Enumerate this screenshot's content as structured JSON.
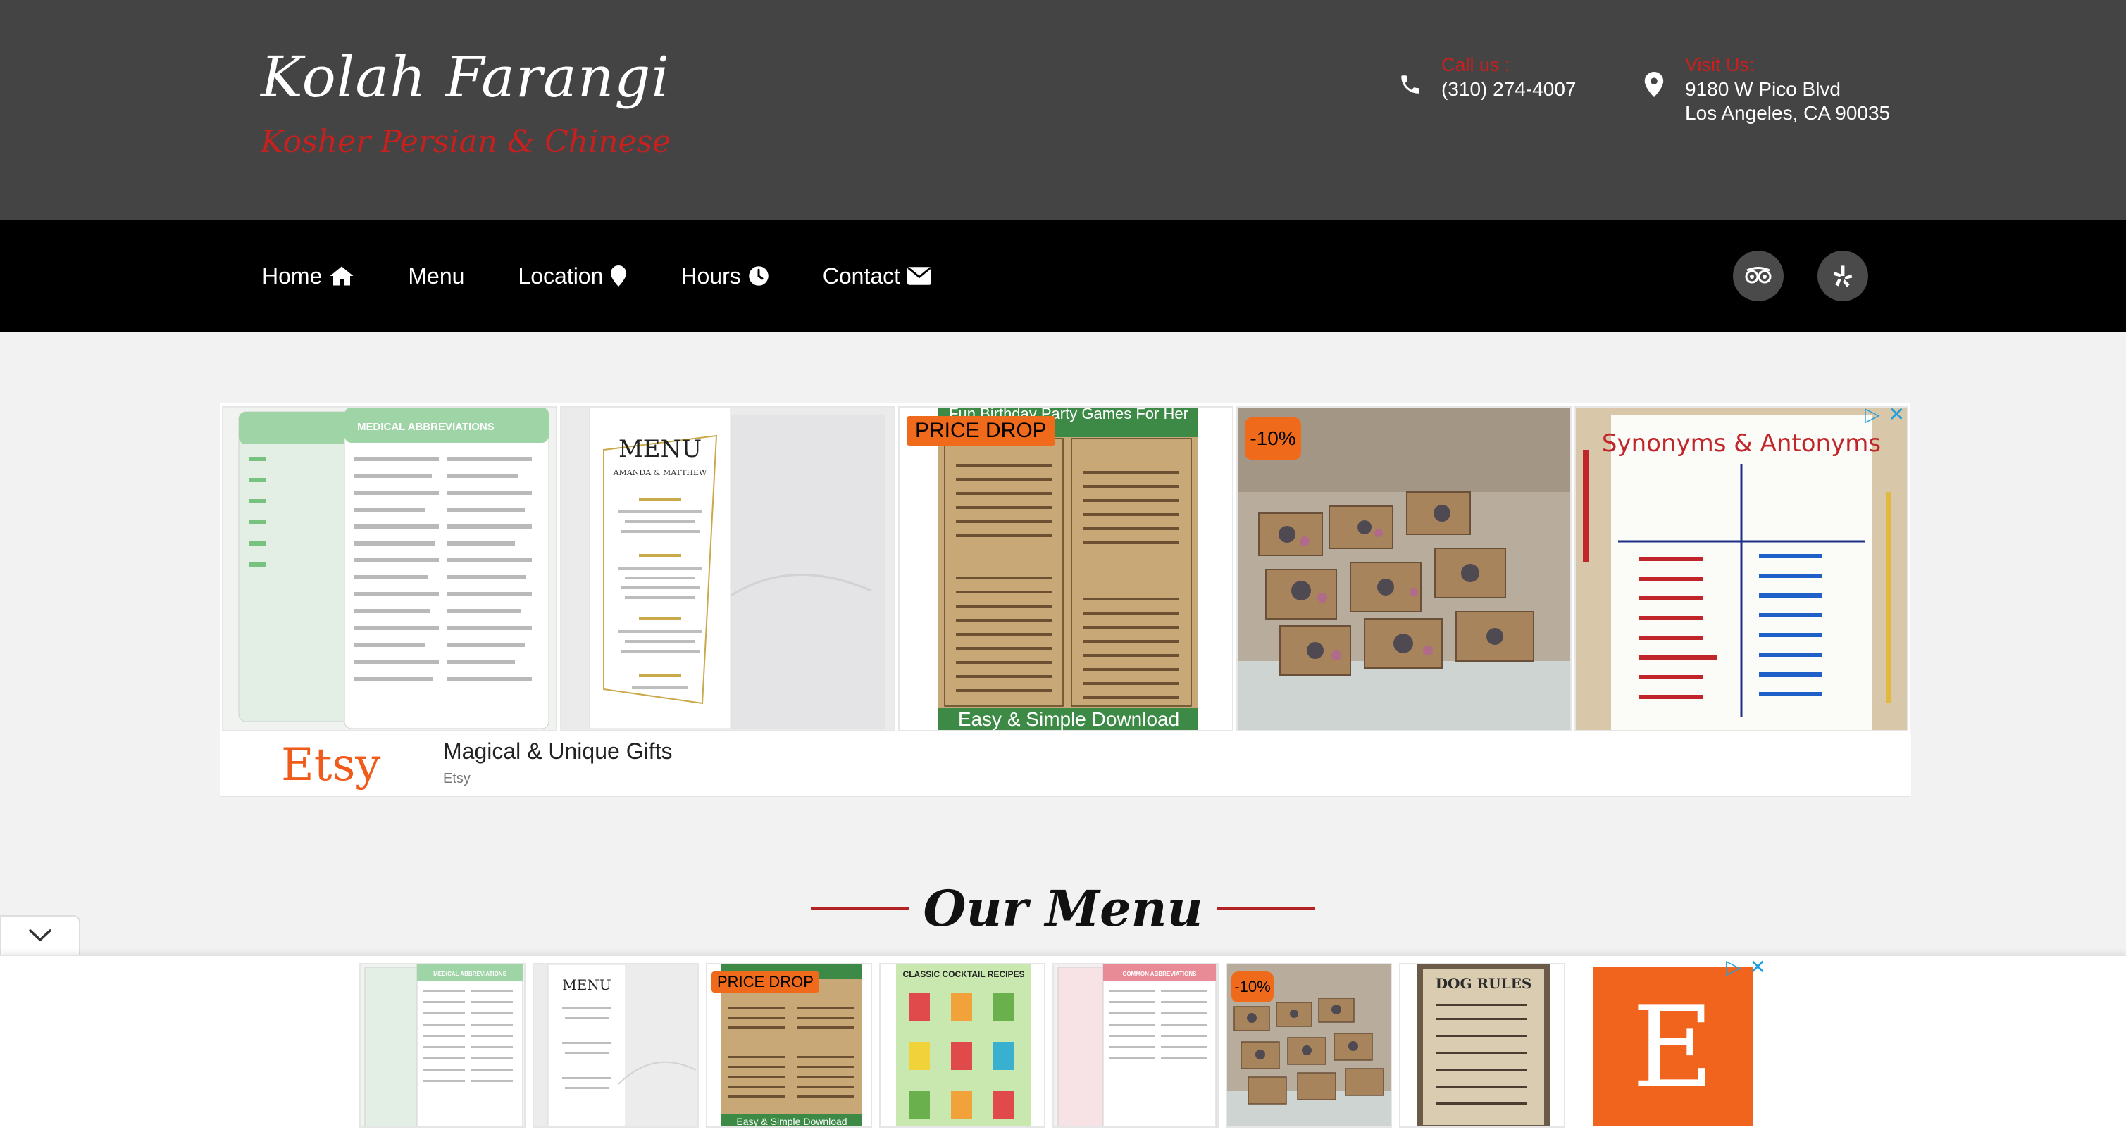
{
  "header": {
    "title": "Kolah Farangi",
    "subtitle": "Kosher Persian & Chinese",
    "call_label": "Call us :",
    "call_value": "(310) 274-4007",
    "visit_label": "Visit Us:",
    "visit_line1": "9180 W Pico Blvd",
    "visit_line2": "Los Angeles, CA 90035"
  },
  "nav": {
    "items": [
      {
        "label": "Home",
        "icon": "home-icon"
      },
      {
        "label": "Menu",
        "icon": ""
      },
      {
        "label": "Location",
        "icon": "map-pin-icon"
      },
      {
        "label": "Hours",
        "icon": "clock-icon"
      },
      {
        "label": "Contact",
        "icon": "envelope-icon"
      }
    ],
    "social": [
      "tripadvisor-icon",
      "yelp-icon"
    ]
  },
  "ad_top": {
    "cards": [
      {
        "heading": "MEDICAL ABBREVIATIONS",
        "badge": ""
      },
      {
        "heading": "MENU",
        "sub": "AMANDA & MATTHEW",
        "badge": ""
      },
      {
        "heading": "Fun Birthday Party Games For Her",
        "badge": "PRICE DROP",
        "footer": "Easy & Simple Download"
      },
      {
        "heading": "",
        "badge": "-10%"
      },
      {
        "heading": "Synonyms & Antonyms",
        "badge": ""
      }
    ],
    "brand": "Etsy",
    "headline": "Magical & Unique Gifts",
    "advertiser": "Etsy"
  },
  "section": {
    "title": "Our Menu"
  },
  "anchor_ad": {
    "cards": [
      {
        "heading": "MEDICAL ABBREVIATIONS",
        "badge": ""
      },
      {
        "heading": "MENU",
        "badge": ""
      },
      {
        "heading": "",
        "badge": "PRICE DROP",
        "footer": "Easy & Simple Download"
      },
      {
        "heading": "CLASSIC COCKTAIL RECIPES",
        "badge": ""
      },
      {
        "heading": "COMMON ABBREVIATIONS",
        "badge": ""
      },
      {
        "heading": "",
        "badge": "-10%"
      },
      {
        "heading": "DOG RULES",
        "badge": ""
      }
    ],
    "brand_letter": "E"
  },
  "colors": {
    "header_bg": "#444444",
    "nav_bg": "#000000",
    "accent_red": "#c8201f",
    "etsy_orange": "#f1641e"
  }
}
